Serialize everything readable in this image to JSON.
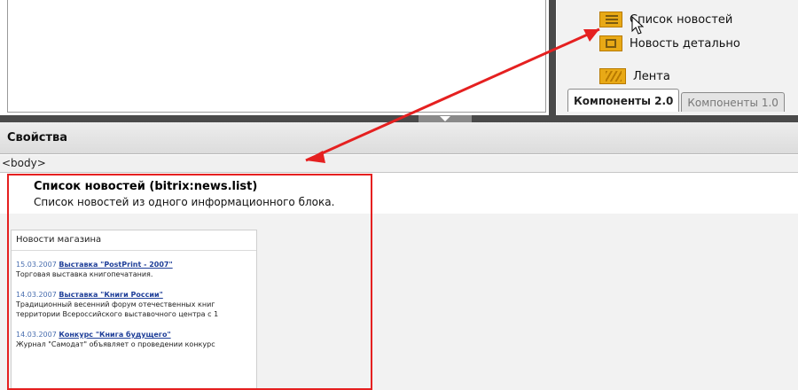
{
  "components_panel": {
    "items": [
      {
        "label": "Список новостей",
        "icon": "news-list-icon"
      },
      {
        "label": "Новость детально",
        "icon": "news-detail-icon"
      },
      {
        "label": "Лента",
        "icon": "tape-icon"
      }
    ],
    "tabs": [
      {
        "label": "Компоненты 2.0",
        "active": true
      },
      {
        "label": "Компоненты 1.0",
        "active": false
      }
    ]
  },
  "properties": {
    "title": "Свойства",
    "breadcrumb": "<body>",
    "component_title": "Список новостей (bitrix:news.list)",
    "component_desc": "Список новостей из одного информационного блока."
  },
  "preview": {
    "header": "Новости магазина",
    "news": [
      {
        "date": "15.03.2007",
        "title": "Выставка \"PostPrint - 2007\"",
        "text": [
          "Торговая выставка книгопечатания."
        ]
      },
      {
        "date": "14.03.2007",
        "title": "Выставка \"Книги России\"",
        "text": [
          "Традиционный весенний форум отечественных книг",
          "территории Всероссийского выставочного центра с 1"
        ]
      },
      {
        "date": "14.03.2007",
        "title": "Конкурс \"Книга будущего\"",
        "text": [
          "Журнал \"Самодат\" объявляет о проведении конкурс"
        ]
      }
    ]
  },
  "colors": {
    "highlight": "#e52020",
    "icon": "#e8a916",
    "splitter": "#4a4a4a"
  }
}
